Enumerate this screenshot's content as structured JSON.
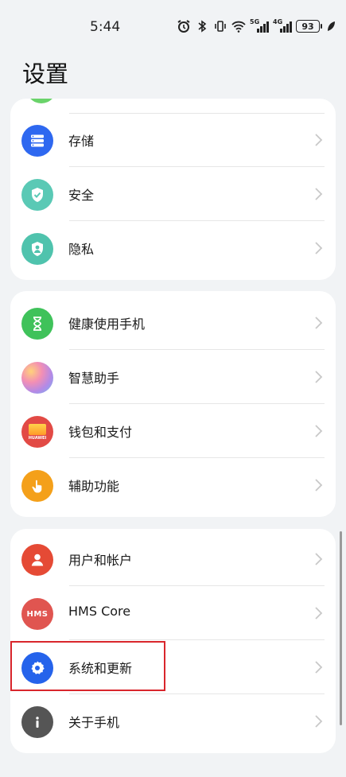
{
  "status": {
    "time": "5:44",
    "battery": "93",
    "sig1": "5G",
    "sig2": "4G"
  },
  "title": "设置",
  "cards": [
    {
      "items": [
        {
          "label": "存储",
          "icon": "storage-icon",
          "color": "#2e68f0"
        },
        {
          "label": "安全",
          "icon": "security-shield-icon",
          "color": "#5ac9b5"
        },
        {
          "label": "隐私",
          "icon": "privacy-icon",
          "color": "#4fc3ad"
        }
      ]
    },
    {
      "items": [
        {
          "label": "健康使用手机",
          "icon": "hourglass-icon",
          "color": "#3fc25a"
        },
        {
          "label": "智慧助手",
          "icon": "assistant-icon",
          "color": "#c58de0"
        },
        {
          "label": "钱包和支付",
          "icon": "wallet-icon",
          "color": "#e24a45",
          "sublabel": "HUAWEI"
        },
        {
          "label": "辅助功能",
          "icon": "hand-pointer-icon",
          "color": "#f4a01a"
        }
      ]
    },
    {
      "items": [
        {
          "label": "用户和帐户",
          "icon": "user-icon",
          "color": "#e54a35"
        },
        {
          "label": "HMS Core",
          "icon": "hms-core-icon",
          "color": "#e05550",
          "sublabel": "HMS"
        },
        {
          "label": "系统和更新",
          "icon": "system-gear-icon",
          "color": "#2563eb"
        },
        {
          "label": "关于手机",
          "icon": "info-icon",
          "color": "#555555"
        }
      ]
    }
  ]
}
